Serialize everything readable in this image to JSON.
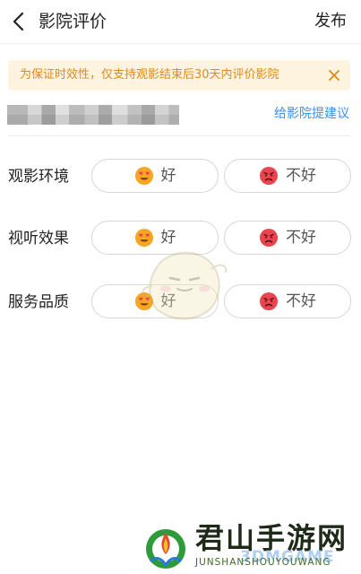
{
  "header": {
    "title": "影院评价",
    "publish_label": "发布"
  },
  "notice": {
    "text": "为保证时效性，仅支持观影结束后30天内评价影院"
  },
  "cinema": {
    "suggest_label": "给影院提建议"
  },
  "rating_rows": [
    {
      "label": "观影环境",
      "good_label": "好",
      "bad_label": "不好"
    },
    {
      "label": "视听效果",
      "good_label": "好",
      "bad_label": "不好"
    },
    {
      "label": "服务品质",
      "good_label": "好",
      "bad_label": "不好"
    }
  ],
  "watermark": {
    "name": "君山手游网",
    "sub": "JUNSHANSHOUYOUWANG",
    "tag": "3DMGAME"
  },
  "colors": {
    "accent_orange": "#e0891a",
    "notice_bg": "#fdf3df",
    "link_blue": "#3d8ee8",
    "good_face": "#f6a623",
    "bad_face": "#e8454f"
  },
  "icons": {
    "back": "chevron-left-icon",
    "close": "close-icon",
    "good": "heart-eyes-face-icon",
    "bad": "frowning-face-icon"
  }
}
